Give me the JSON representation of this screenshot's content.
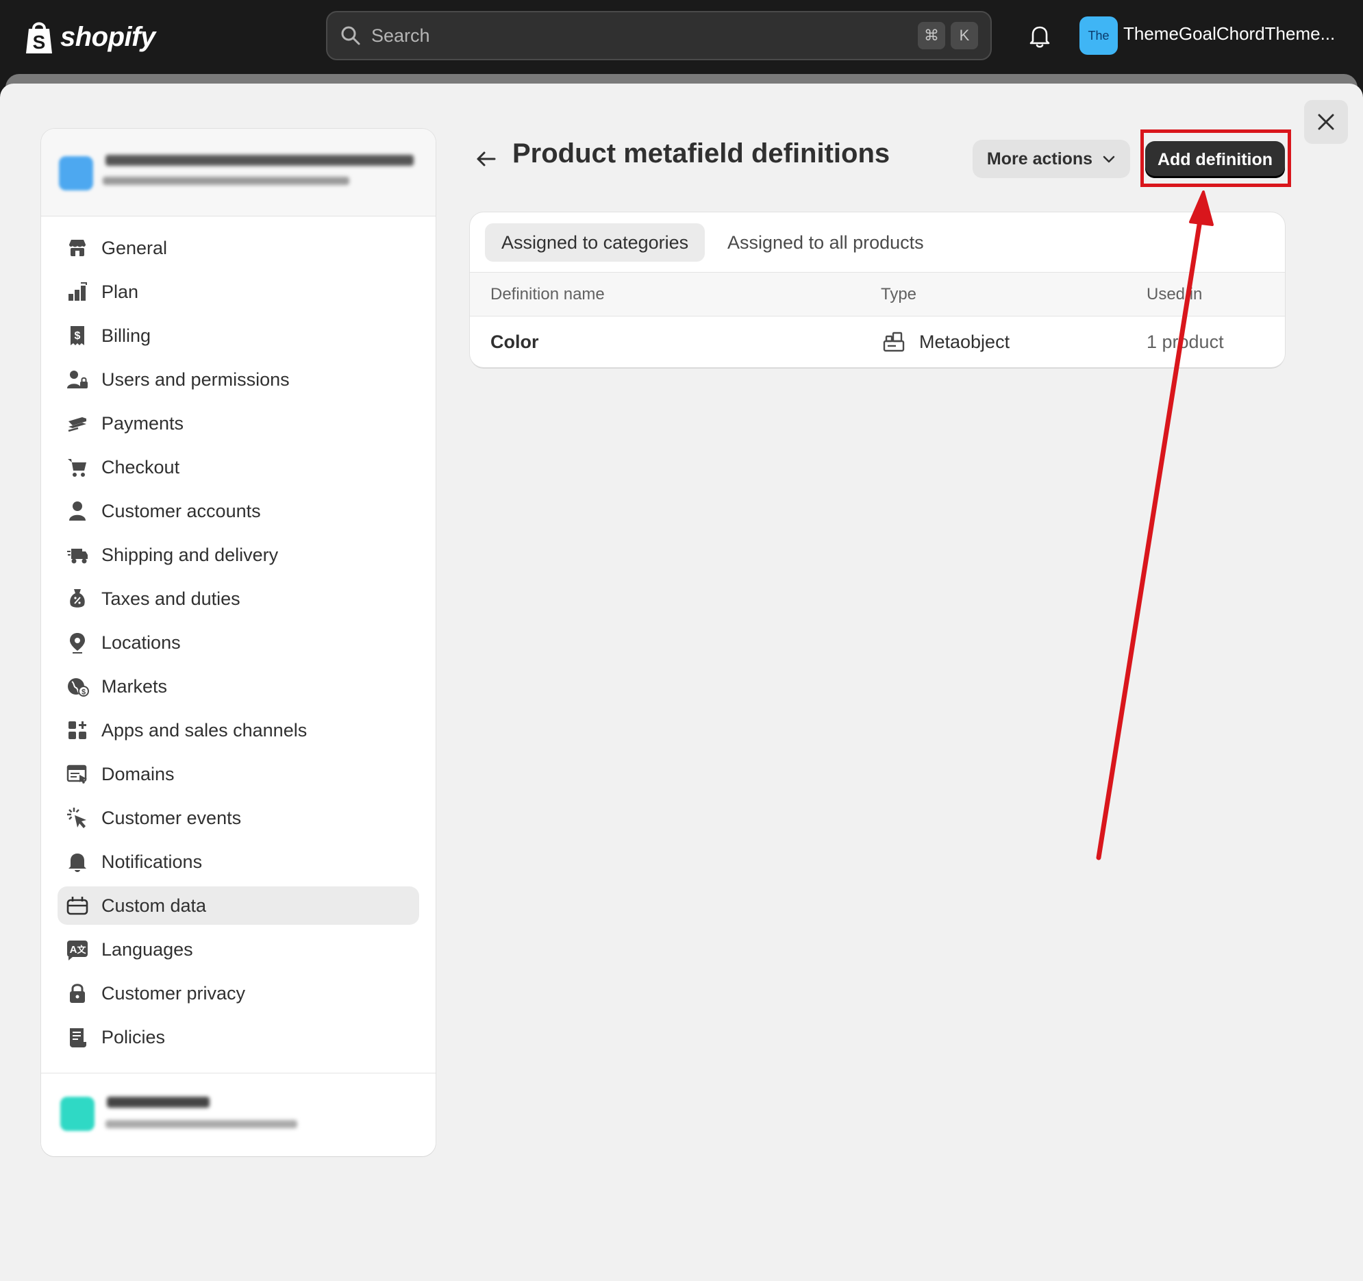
{
  "topbar": {
    "logo_text": "shopify",
    "search_placeholder": "Search",
    "shortcut_keys": [
      "⌘",
      "K"
    ],
    "store_initials": "The",
    "store_name": "ThemeGoalChordTheme..."
  },
  "page": {
    "title": "Product metafield definitions",
    "more_actions_label": "More actions",
    "add_definition_label": "Add definition"
  },
  "sidebar": {
    "items": [
      {
        "label": "General",
        "icon": "store-icon"
      },
      {
        "label": "Plan",
        "icon": "plan-icon"
      },
      {
        "label": "Billing",
        "icon": "receipt-dollar-icon"
      },
      {
        "label": "Users and permissions",
        "icon": "person-lock-icon"
      },
      {
        "label": "Payments",
        "icon": "credit-card-icon"
      },
      {
        "label": "Checkout",
        "icon": "cart-icon"
      },
      {
        "label": "Customer accounts",
        "icon": "person-icon"
      },
      {
        "label": "Shipping and delivery",
        "icon": "truck-icon"
      },
      {
        "label": "Taxes and duties",
        "icon": "tax-icon"
      },
      {
        "label": "Locations",
        "icon": "location-pin-icon"
      },
      {
        "label": "Markets",
        "icon": "globe-dollar-icon"
      },
      {
        "label": "Apps and sales channels",
        "icon": "apps-icon"
      },
      {
        "label": "Domains",
        "icon": "domain-icon"
      },
      {
        "label": "Customer events",
        "icon": "cursor-click-icon"
      },
      {
        "label": "Notifications",
        "icon": "bell-icon"
      },
      {
        "label": "Custom data",
        "icon": "metafields-icon"
      },
      {
        "label": "Languages",
        "icon": "language-icon"
      },
      {
        "label": "Customer privacy",
        "icon": "lock-icon"
      },
      {
        "label": "Policies",
        "icon": "policy-icon"
      }
    ],
    "active_item": "Custom data"
  },
  "tabs": [
    {
      "label": "Assigned to categories",
      "selected": true
    },
    {
      "label": "Assigned to all products",
      "selected": false
    }
  ],
  "table": {
    "columns": [
      "Definition name",
      "Type",
      "Used in"
    ],
    "rows": [
      {
        "name": "Color",
        "type": "Metaobject",
        "type_icon": "metaobject-icon",
        "used_in": "1 product"
      }
    ]
  },
  "colors": {
    "accent_store": "#3fb5f5",
    "primary_button": "#303030",
    "annotation_red": "#d9161c"
  }
}
